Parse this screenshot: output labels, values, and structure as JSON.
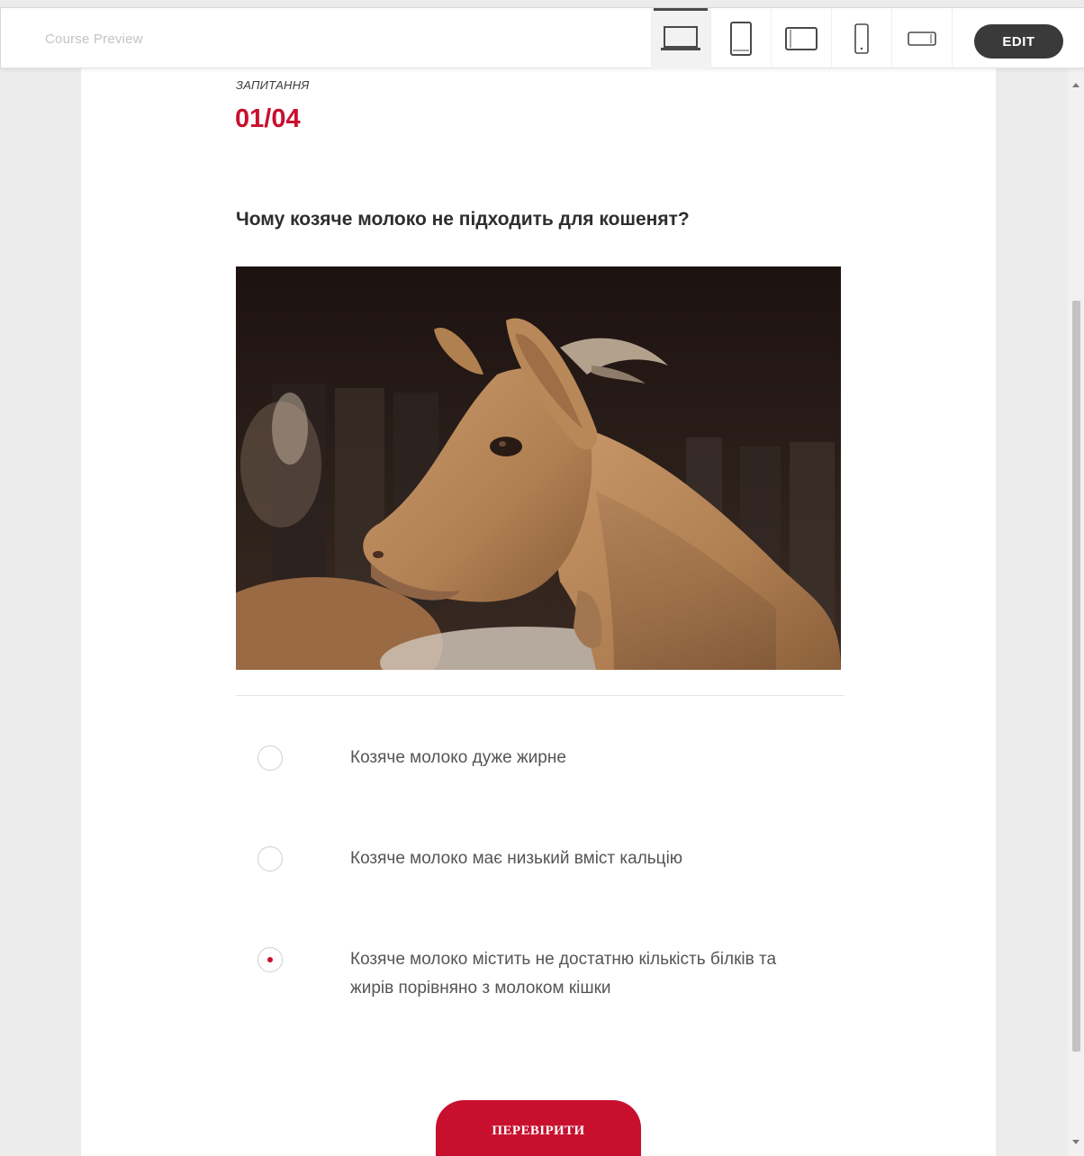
{
  "header": {
    "title": "Course Preview",
    "edit_label": "EDIT",
    "devices": [
      {
        "name": "desktop-icon",
        "active": true
      },
      {
        "name": "tablet-portrait-icon",
        "active": false
      },
      {
        "name": "tablet-landscape-icon",
        "active": false
      },
      {
        "name": "phone-portrait-icon",
        "active": false
      },
      {
        "name": "phone-landscape-icon",
        "active": false
      }
    ]
  },
  "question": {
    "label": "ЗАПИТАННЯ",
    "counter": "01/04",
    "text": "Чому козяче молоко не підходить для кошенят?",
    "image": "goat-photo",
    "options": [
      {
        "text": "Козяче молоко дуже жирне",
        "selected": false
      },
      {
        "text": "Козяче молоко має низький вміст кальцію",
        "selected": false
      },
      {
        "text": "Козяче молоко містить не достатню кількість білків та жирів порівняно з молоком кішки",
        "selected": true
      }
    ],
    "submit_label": "ПЕРЕВІРИТИ"
  },
  "colors": {
    "accent": "#c8102e",
    "edit_button": "#3a3a3a"
  }
}
